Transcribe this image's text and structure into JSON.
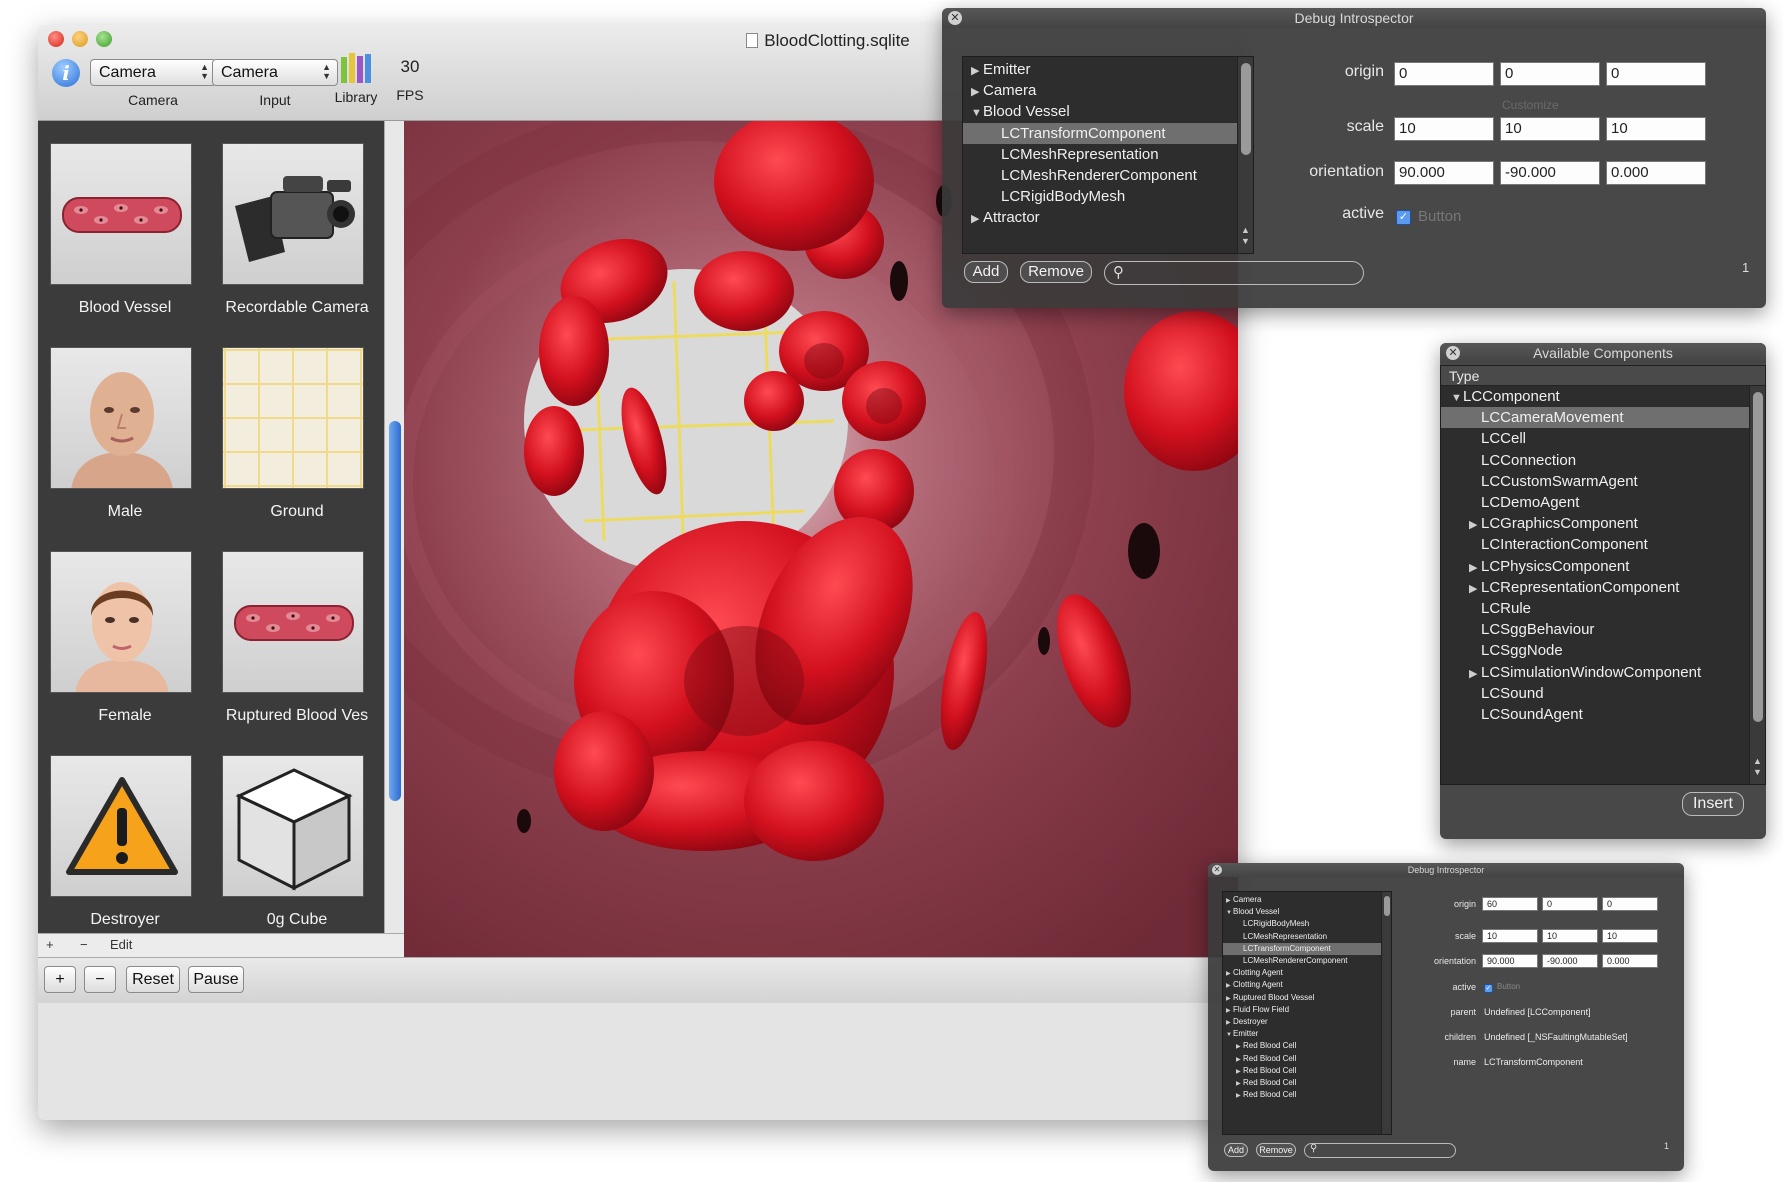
{
  "main_window": {
    "title": "BloodClotting.sqlite",
    "toolbar": {
      "camera_popup": "Camera",
      "camera_label": "Camera",
      "input_popup": "Camera",
      "input_label": "Input",
      "library_label": "Library",
      "fps_value": "30",
      "fps_label": "FPS"
    },
    "library": {
      "items": [
        {
          "name": "Blood Vessel",
          "icon": "blood-vessel-thumbnail"
        },
        {
          "name": "Recordable Camera",
          "icon": "video-camera-thumbnail"
        },
        {
          "name": "Male",
          "icon": "male-head-thumbnail"
        },
        {
          "name": "Ground",
          "icon": "grid-thumbnail"
        },
        {
          "name": "Female",
          "icon": "female-head-thumbnail"
        },
        {
          "name": "Ruptured Blood Ves",
          "icon": "blood-vessel-thumbnail"
        },
        {
          "name": "Destroyer",
          "icon": "warning-triangle-thumbnail"
        },
        {
          "name": "0g Cube",
          "icon": "cube-thumbnail"
        }
      ],
      "footer": {
        "add": "+",
        "remove": "−",
        "edit": "Edit"
      }
    },
    "bottom_bar": {
      "add": "+",
      "remove": "−",
      "reset": "Reset",
      "pause": "Pause"
    }
  },
  "introspector": {
    "title": "Debug Introspector",
    "tree": [
      {
        "label": "Emitter",
        "level": 0,
        "expanded": false,
        "selected": false
      },
      {
        "label": "Camera",
        "level": 0,
        "expanded": false,
        "selected": false
      },
      {
        "label": "Blood Vessel",
        "level": 0,
        "expanded": true,
        "selected": false
      },
      {
        "label": "LCTransformComponent",
        "level": 1,
        "expanded": null,
        "selected": true
      },
      {
        "label": "LCMeshRepresentation",
        "level": 1,
        "expanded": null,
        "selected": false
      },
      {
        "label": "LCMeshRendererComponent",
        "level": 1,
        "expanded": null,
        "selected": false
      },
      {
        "label": "LCRigidBodyMesh",
        "level": 1,
        "expanded": null,
        "selected": false
      },
      {
        "label": "Attractor",
        "level": 0,
        "expanded": false,
        "selected": false
      }
    ],
    "props": {
      "origin_label": "origin",
      "origin": [
        "0",
        "0",
        "0"
      ],
      "scale_label": "scale",
      "scale": [
        "10",
        "10",
        "10"
      ],
      "orientation_label": "orientation",
      "orientation": [
        "90.000",
        "-90.000",
        "0.000"
      ],
      "active_label": "active",
      "active_checkbox": "Button",
      "customize": "Customize"
    },
    "add": "Add",
    "remove": "Remove",
    "count": "1"
  },
  "components": {
    "title": "Available Components",
    "column": "Type",
    "items": [
      {
        "label": "LCComponent",
        "level": 0,
        "expanded": true,
        "selected": false
      },
      {
        "label": "LCCameraMovement",
        "level": 1,
        "expanded": null,
        "selected": true
      },
      {
        "label": "LCCell",
        "level": 1,
        "expanded": null,
        "selected": false
      },
      {
        "label": "LCConnection",
        "level": 1,
        "expanded": null,
        "selected": false
      },
      {
        "label": "LCCustomSwarmAgent",
        "level": 1,
        "expanded": null,
        "selected": false
      },
      {
        "label": "LCDemoAgent",
        "level": 1,
        "expanded": null,
        "selected": false
      },
      {
        "label": "LCGraphicsComponent",
        "level": 1,
        "expanded": false,
        "selected": false
      },
      {
        "label": "LCInteractionComponent",
        "level": 1,
        "expanded": null,
        "selected": false
      },
      {
        "label": "LCPhysicsComponent",
        "level": 1,
        "expanded": false,
        "selected": false
      },
      {
        "label": "LCRepresentationComponent",
        "level": 1,
        "expanded": false,
        "selected": false
      },
      {
        "label": "LCRule",
        "level": 1,
        "expanded": null,
        "selected": false
      },
      {
        "label": "LCSggBehaviour",
        "level": 1,
        "expanded": null,
        "selected": false
      },
      {
        "label": "LCSggNode",
        "level": 1,
        "expanded": null,
        "selected": false
      },
      {
        "label": "LCSimulationWindowComponent",
        "level": 1,
        "expanded": false,
        "selected": false
      },
      {
        "label": "LCSound",
        "level": 1,
        "expanded": null,
        "selected": false
      },
      {
        "label": "LCSoundAgent",
        "level": 1,
        "expanded": null,
        "selected": false
      }
    ],
    "insert": "Insert"
  },
  "small_introspector": {
    "title": "Debug Introspector",
    "tree": [
      {
        "label": "Camera",
        "level": 0,
        "expanded": false,
        "selected": false
      },
      {
        "label": "Blood Vessel",
        "level": 0,
        "expanded": true,
        "selected": false
      },
      {
        "label": "LCRigidBodyMesh",
        "level": 1,
        "expanded": null,
        "selected": false
      },
      {
        "label": "LCMeshRepresentation",
        "level": 1,
        "expanded": null,
        "selected": false
      },
      {
        "label": "LCTransformComponent",
        "level": 1,
        "expanded": null,
        "selected": true
      },
      {
        "label": "LCMeshRendererComponent",
        "level": 1,
        "expanded": null,
        "selected": false
      },
      {
        "label": "Clotting Agent",
        "level": 0,
        "expanded": false,
        "selected": false
      },
      {
        "label": "Clotting Agent",
        "level": 0,
        "expanded": false,
        "selected": false
      },
      {
        "label": "Ruptured Blood Vessel",
        "level": 0,
        "expanded": false,
        "selected": false
      },
      {
        "label": "Fluid Flow Field",
        "level": 0,
        "expanded": false,
        "selected": false
      },
      {
        "label": "Destroyer",
        "level": 0,
        "expanded": false,
        "selected": false
      },
      {
        "label": "Emitter",
        "level": 0,
        "expanded": true,
        "selected": false
      },
      {
        "label": "Red Blood Cell",
        "level": 1,
        "expanded": false,
        "selected": false
      },
      {
        "label": "Red Blood Cell",
        "level": 1,
        "expanded": false,
        "selected": false
      },
      {
        "label": "Red Blood Cell",
        "level": 1,
        "expanded": false,
        "selected": false
      },
      {
        "label": "Red Blood Cell",
        "level": 1,
        "expanded": false,
        "selected": false
      },
      {
        "label": "Red Blood Cell",
        "level": 1,
        "expanded": false,
        "selected": false
      }
    ],
    "props": {
      "origin_label": "origin",
      "origin": [
        "60",
        "0",
        "0"
      ],
      "scale_label": "scale",
      "scale": [
        "10",
        "10",
        "10"
      ],
      "orientation_label": "orientation",
      "orientation": [
        "90.000",
        "-90.000",
        "0.000"
      ],
      "active_label": "active",
      "active_checkbox": "Button",
      "parent_label": "parent",
      "parent": "Undefined [LCComponent]",
      "children_label": "children",
      "children": "Undefined [_NSFaultingMutableSet]",
      "name_label": "name",
      "name": "LCTransformComponent"
    },
    "add": "Add",
    "remove": "Remove",
    "count": "1"
  },
  "colors": {
    "blood_red": "#c8101c",
    "vessel_wall": "#9b4a57",
    "hud_bg": "#3a3a3a",
    "selection_blue": "#2e6bd0"
  }
}
